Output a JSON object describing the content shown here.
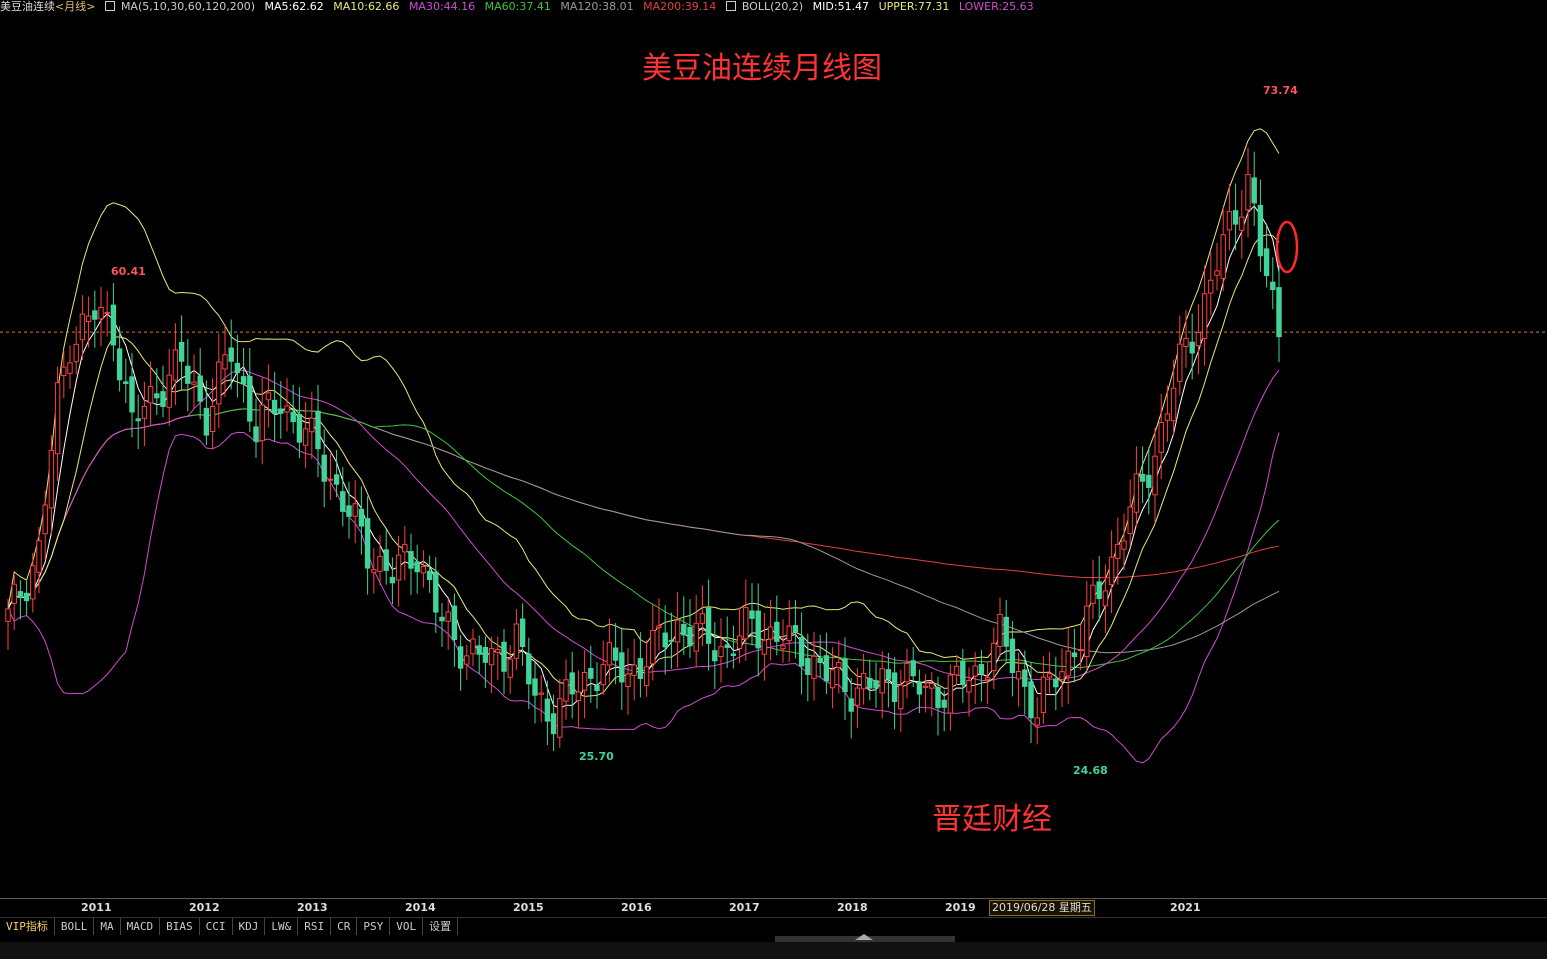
{
  "header": {
    "symbol": "美豆油连续",
    "period": "<月线>",
    "ma_label": "MA(5,10,30,60,120,200)",
    "ma5": "MA5:62.62",
    "ma10": "MA10:62.66",
    "ma30": "MA30:44.16",
    "ma60": "MA60:37.41",
    "ma120": "MA120:38.01",
    "ma200": "MA200:39.14",
    "boll_label": "BOLL(20,2)",
    "mid": "MID:51.47",
    "upper": "UPPER:77.31",
    "lower": "LOWER:25.63"
  },
  "colors": {
    "ma5": "#ffffff",
    "ma10": "#e8e87a",
    "ma30": "#d14cd1",
    "ma60": "#3fc43f",
    "ma120": "#9a9a9a",
    "ma200": "#e04040",
    "up": "#ff4040",
    "down": "#41d49a",
    "boll_mid": "#ffffff",
    "boll_upper": "#e8e87a",
    "boll_lower": "#d14cd1",
    "label_red": "#ff3333",
    "ref_line": "#d08030"
  },
  "annotations": {
    "title": "美豆油连续月线图",
    "watermark": "晋廷财经",
    "high_2011": "60.41",
    "low_2015": "25.70",
    "low_2019": "24.68",
    "high_2021": "73.74"
  },
  "xaxis": {
    "labels": [
      "2011",
      "2012",
      "2013",
      "2014",
      "2015",
      "2016",
      "2017",
      "2018",
      "2019",
      "2021"
    ],
    "cursor": "2019/06/28 星期五"
  },
  "tabs": [
    "VIP指标",
    "BOLL",
    "MA",
    "MACD",
    "BIAS",
    "CCI",
    "KDJ",
    "LW&",
    "RSI",
    "CR",
    "PSY",
    "VOL",
    "设置"
  ],
  "chart_data": {
    "type": "candlestick",
    "title": "美豆油连续月线图",
    "ylim": [
      22,
      80
    ],
    "reference_price": 57.6,
    "x_range": [
      "2010-07",
      "2021-12"
    ],
    "series": [
      {
        "name": "MA5",
        "value": 62.62
      },
      {
        "name": "MA10",
        "value": 62.66
      },
      {
        "name": "MA30",
        "value": 44.16
      },
      {
        "name": "MA60",
        "value": 37.41
      },
      {
        "name": "MA120",
        "value": 38.01
      },
      {
        "name": "MA200",
        "value": 39.14
      },
      {
        "name": "BOLL MID",
        "value": 51.47
      },
      {
        "name": "BOLL UPPER",
        "value": 77.31
      },
      {
        "name": "BOLL LOWER",
        "value": 25.63
      }
    ],
    "anchors": [
      {
        "t": 0,
        "p": 34.5
      },
      {
        "t": 5,
        "p": 40
      },
      {
        "t": 8,
        "p": 52
      },
      {
        "t": 10,
        "p": 57
      },
      {
        "t": 14,
        "p": 59
      },
      {
        "t": 17,
        "p": 58
      },
      {
        "t": 20,
        "p": 50
      },
      {
        "t": 24,
        "p": 53
      },
      {
        "t": 28,
        "p": 55
      },
      {
        "t": 32,
        "p": 51
      },
      {
        "t": 36,
        "p": 56
      },
      {
        "t": 40,
        "p": 50
      },
      {
        "t": 44,
        "p": 52
      },
      {
        "t": 50,
        "p": 48
      },
      {
        "t": 54,
        "p": 44
      },
      {
        "t": 58,
        "p": 40
      },
      {
        "t": 62,
        "p": 38
      },
      {
        "t": 66,
        "p": 40
      },
      {
        "t": 70,
        "p": 34
      },
      {
        "t": 74,
        "p": 32
      },
      {
        "t": 78,
        "p": 31
      },
      {
        "t": 82,
        "p": 33
      },
      {
        "t": 85,
        "p": 28
      },
      {
        "t": 88,
        "p": 27
      },
      {
        "t": 92,
        "p": 29
      },
      {
        "t": 96,
        "p": 31
      },
      {
        "t": 100,
        "p": 30
      },
      {
        "t": 104,
        "p": 32
      },
      {
        "t": 108,
        "p": 34
      },
      {
        "t": 112,
        "p": 33
      },
      {
        "t": 116,
        "p": 32
      },
      {
        "t": 120,
        "p": 34
      },
      {
        "t": 124,
        "p": 33
      },
      {
        "t": 128,
        "p": 32
      },
      {
        "t": 132,
        "p": 30
      },
      {
        "t": 136,
        "p": 29
      },
      {
        "t": 140,
        "p": 29
      },
      {
        "t": 144,
        "p": 30
      },
      {
        "t": 148,
        "p": 28.5
      },
      {
        "t": 152,
        "p": 29
      },
      {
        "t": 156,
        "p": 30
      },
      {
        "t": 160,
        "p": 33
      },
      {
        "t": 164,
        "p": 29
      },
      {
        "t": 166,
        "p": 27
      },
      {
        "t": 169,
        "p": 30
      },
      {
        "t": 173,
        "p": 33
      },
      {
        "t": 177,
        "p": 38
      },
      {
        "t": 181,
        "p": 43
      },
      {
        "t": 185,
        "p": 48
      },
      {
        "t": 189,
        "p": 55
      },
      {
        "t": 193,
        "p": 60
      },
      {
        "t": 197,
        "p": 66
      },
      {
        "t": 200,
        "p": 70
      },
      {
        "t": 202,
        "p": 64
      },
      {
        "t": 203,
        "p": 62
      },
      {
        "t": 205,
        "p": 57.5
      }
    ]
  }
}
